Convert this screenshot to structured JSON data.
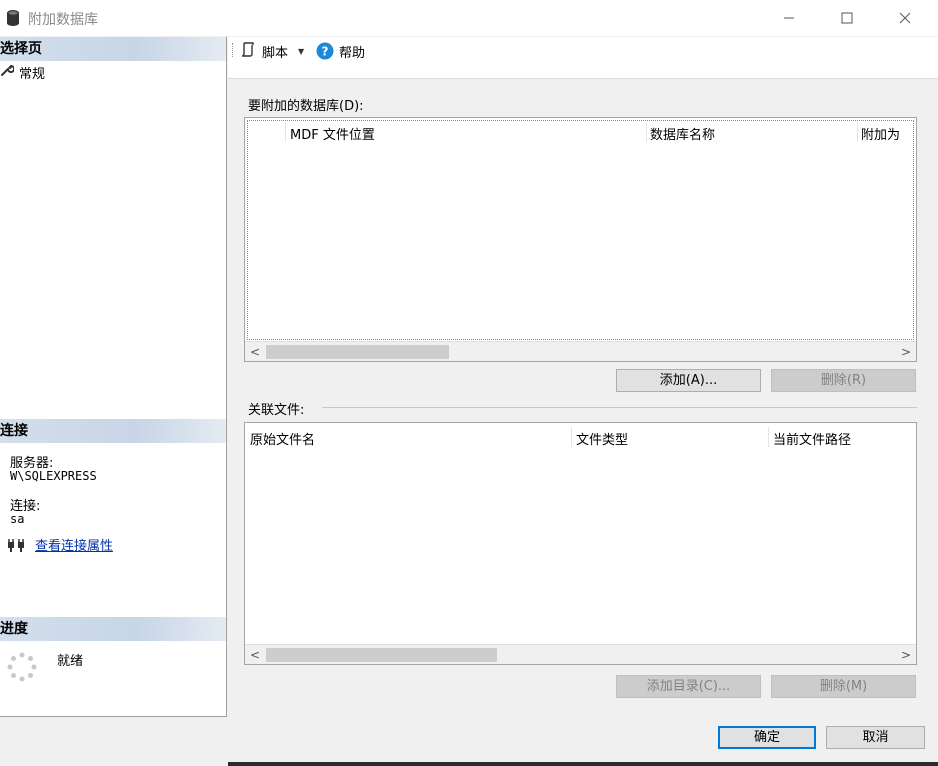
{
  "window": {
    "title": "附加数据库",
    "minimize_symbol": "—",
    "maximize_symbol": "☐",
    "close_symbol": "✕"
  },
  "left_panel": {
    "select_page_header": "选择页",
    "pages": [
      {
        "label": "常规",
        "icon": "wrench-icon"
      }
    ],
    "connection_header": "连接",
    "server_label": "服务器:",
    "server_value": "W\\SQLEXPRESS",
    "connection_label": "连接:",
    "connection_value": "sa",
    "view_properties_link": "查看连接属性",
    "progress_header": "进度",
    "progress_status": "就绪"
  },
  "toolbar": {
    "script_label": "脚本",
    "help_label": "帮助"
  },
  "databases": {
    "section_label": "要附加的数据库(D):",
    "columns": [
      "MDF 文件位置",
      "数据库名称",
      "附加为"
    ],
    "add_button": "添加(A)...",
    "remove_button": "删除(R)"
  },
  "related_files": {
    "section_label": "关联文件:",
    "columns": [
      "原始文件名",
      "文件类型",
      "当前文件路径"
    ],
    "add_catalog_button": "添加目录(C)...",
    "remove_button": "删除(M)"
  },
  "footer": {
    "ok_button": "确定",
    "cancel_button": "取消"
  },
  "colors": {
    "link": "#0033aa",
    "primary_border": "#0078d7",
    "help_icon": "#1e88d8"
  }
}
